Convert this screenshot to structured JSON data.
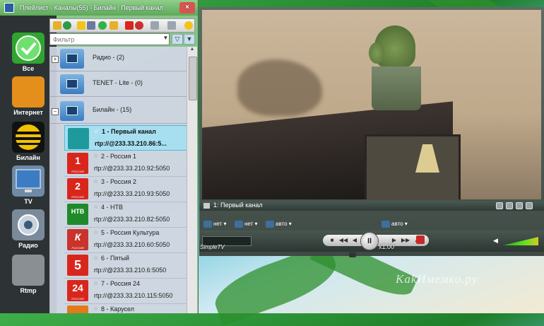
{
  "playlist_window": {
    "title": "Плейлист - Каналы(55) - Билайн : Первый канал",
    "close_label": "×"
  },
  "sidebar": {
    "items": [
      {
        "label": "Все",
        "icon": "checkmark-icon",
        "color": "#2fa52f"
      },
      {
        "label": "Интернет",
        "icon": "folder-globe-icon",
        "color": "#e48f1c"
      },
      {
        "label": "Билайн",
        "icon": "beeline-icon",
        "color": "#f2c200"
      },
      {
        "label": "TV",
        "icon": "tv-icon",
        "color": "#3c7cc4"
      },
      {
        "label": "Радио",
        "icon": "radio-icon",
        "color": "#7a8a9a"
      },
      {
        "label": "Rtmp",
        "icon": "rtmp-icon",
        "color": "#8a8f94"
      }
    ]
  },
  "filter": {
    "placeholder": "Фильтр",
    "value": "Фильтр"
  },
  "groups": [
    {
      "label": "Радио - (2)",
      "expander": "+"
    },
    {
      "label": "TENET - Lite - (0)",
      "expander": ""
    },
    {
      "label": "Билайн - (15)",
      "expander": "−"
    }
  ],
  "channels": [
    {
      "name": "1 - Первый канал",
      "url": "rtp://@233.33.210.86:5...",
      "logo_text": "",
      "logo_color": "#1f9a9c",
      "selected": true
    },
    {
      "name": "2 - Россия 1",
      "url": "rtp://@233.33.210.92:5050",
      "logo_text": "1",
      "logo_sub": "РОССИЯ",
      "logo_color": "#d9261c"
    },
    {
      "name": "3 - Россия 2",
      "url": "rtp://@233.33.210.93:5050",
      "logo_text": "2",
      "logo_sub": "РОССИЯ",
      "logo_color": "#d9261c"
    },
    {
      "name": "4 - НТВ",
      "url": "rtp://@233.33.210.82:5050",
      "logo_text": "НТВ",
      "logo_color": "#1e8a2a"
    },
    {
      "name": "5 - Россия Культура",
      "url": "rtp://@233.33.210.60:5050",
      "logo_text": "К",
      "logo_sub": "РОССИЯ",
      "logo_color": "#c9332b"
    },
    {
      "name": "6 - Пятый",
      "url": "rtp://@233.33.210.6:5050",
      "logo_text": "5",
      "logo_color": "#d9261c"
    },
    {
      "name": "7 - Россия 24",
      "url": "rtp://@233.33.210.115:5050",
      "logo_text": "24",
      "logo_sub": "РОССИЯ",
      "logo_color": "#d9261c"
    },
    {
      "name": "8 - Карусел",
      "url": "",
      "logo_text": "",
      "logo_color": "#e07a1c"
    }
  ],
  "player": {
    "now_playing": "1: Первый канал",
    "audio_label": "нет",
    "subtitle_label": "нет",
    "aspect_label": "авто",
    "zoom_label": "авто",
    "speed": "x1.00",
    "brand": "SimpleTV"
  },
  "watermark": "KakИмемко.ру"
}
